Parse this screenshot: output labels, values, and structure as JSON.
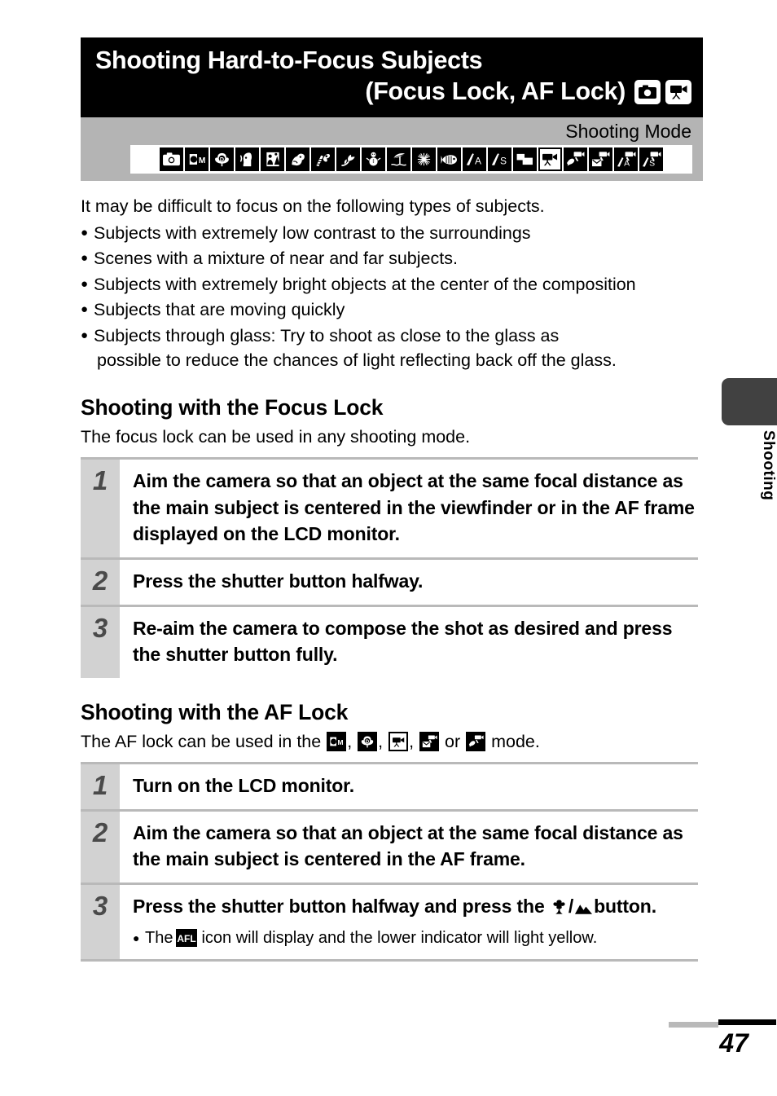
{
  "header": {
    "title_line_1": "Shooting Hard-to-Focus Subjects",
    "title_line_2": "(Focus Lock, AF Lock)",
    "title_icons": [
      "still-camera-icon",
      "movie-camera-icon"
    ],
    "mode_label": "Shooting Mode",
    "mode_icons": [
      "auto-camera-icon",
      "manual-icon",
      "digital-macro-icon",
      "portrait-icon",
      "night-snapshot-icon",
      "kids-and-pets-icon",
      "indoor-icon",
      "foliage-icon",
      "snow-icon",
      "beach-icon",
      "fireworks-icon",
      "underwater-icon",
      "aperture-priority-icon",
      "shutter-priority-icon",
      "stitch-assist-icon",
      "movie-standard-icon",
      "movie-my-colors-icon",
      "movie-compact-icon",
      "movie-aperture-icon",
      "movie-shutter-icon"
    ]
  },
  "intro": {
    "lead": "It may be difficult to focus on the following types of subjects.",
    "bullets": [
      "Subjects with extremely low contrast to the surroundings",
      "Scenes with a mixture of near and far subjects.",
      "Subjects with extremely bright objects at the center of the composition",
      "Subjects that are moving quickly",
      "Subjects through glass: Try to shoot as close to the glass as"
    ],
    "bullet_5_continuation": "possible to reduce the chances of light reflecting back off the glass."
  },
  "focus_lock": {
    "heading": "Shooting with the Focus Lock",
    "subtitle": "The focus lock can be used in any shooting mode.",
    "steps": [
      {
        "num": "1",
        "text": "Aim the camera so that an object at the same focal distance as the main subject is centered in the viewfinder or in the AF frame displayed on the LCD monitor."
      },
      {
        "num": "2",
        "text": "Press the shutter button halfway."
      },
      {
        "num": "3",
        "text": "Re-aim the camera to compose the shot as desired and press the shutter button fully."
      }
    ]
  },
  "af_lock": {
    "heading": "Shooting with the AF Lock",
    "subtitle_part_1": "The AF lock can be used in the ",
    "subtitle_sep_1": ", ",
    "subtitle_sep_2": ", ",
    "subtitle_sep_3": ", ",
    "subtitle_or": " or ",
    "subtitle_end": " mode.",
    "subtitle_icons": [
      "manual-icon",
      "digital-macro-icon",
      "movie-standard-icon",
      "movie-compact-icon",
      "movie-my-colors-icon"
    ],
    "steps": [
      {
        "num": "1",
        "text": "Turn on the LCD monitor."
      },
      {
        "num": "2",
        "text": "Aim the camera so that an object at the same focal distance as the main subject is centered in the AF frame."
      }
    ],
    "step3": {
      "num": "3",
      "text_part_1": "Press the shutter button halfway and press the ",
      "macro_icon": "macro-flower-icon",
      "slash": "/",
      "infinity_icon": "infinity-mountain-icon",
      "text_part_2": "button.",
      "note_part_1": "The ",
      "note_icon_label": "AFL",
      "note_part_2": " icon will display and the lower indicator will light yellow."
    }
  },
  "side_tab": {
    "label": "Shooting"
  },
  "footer": {
    "page_number": "47"
  },
  "colors": {
    "title_bg": "#000000",
    "mode_band_bg": "#b4b4b4",
    "step_num_bg": "#d2d2d2",
    "step_num_fg": "#4a4a4a",
    "rule": "#b9b9b9",
    "side_tab": "#414141"
  }
}
